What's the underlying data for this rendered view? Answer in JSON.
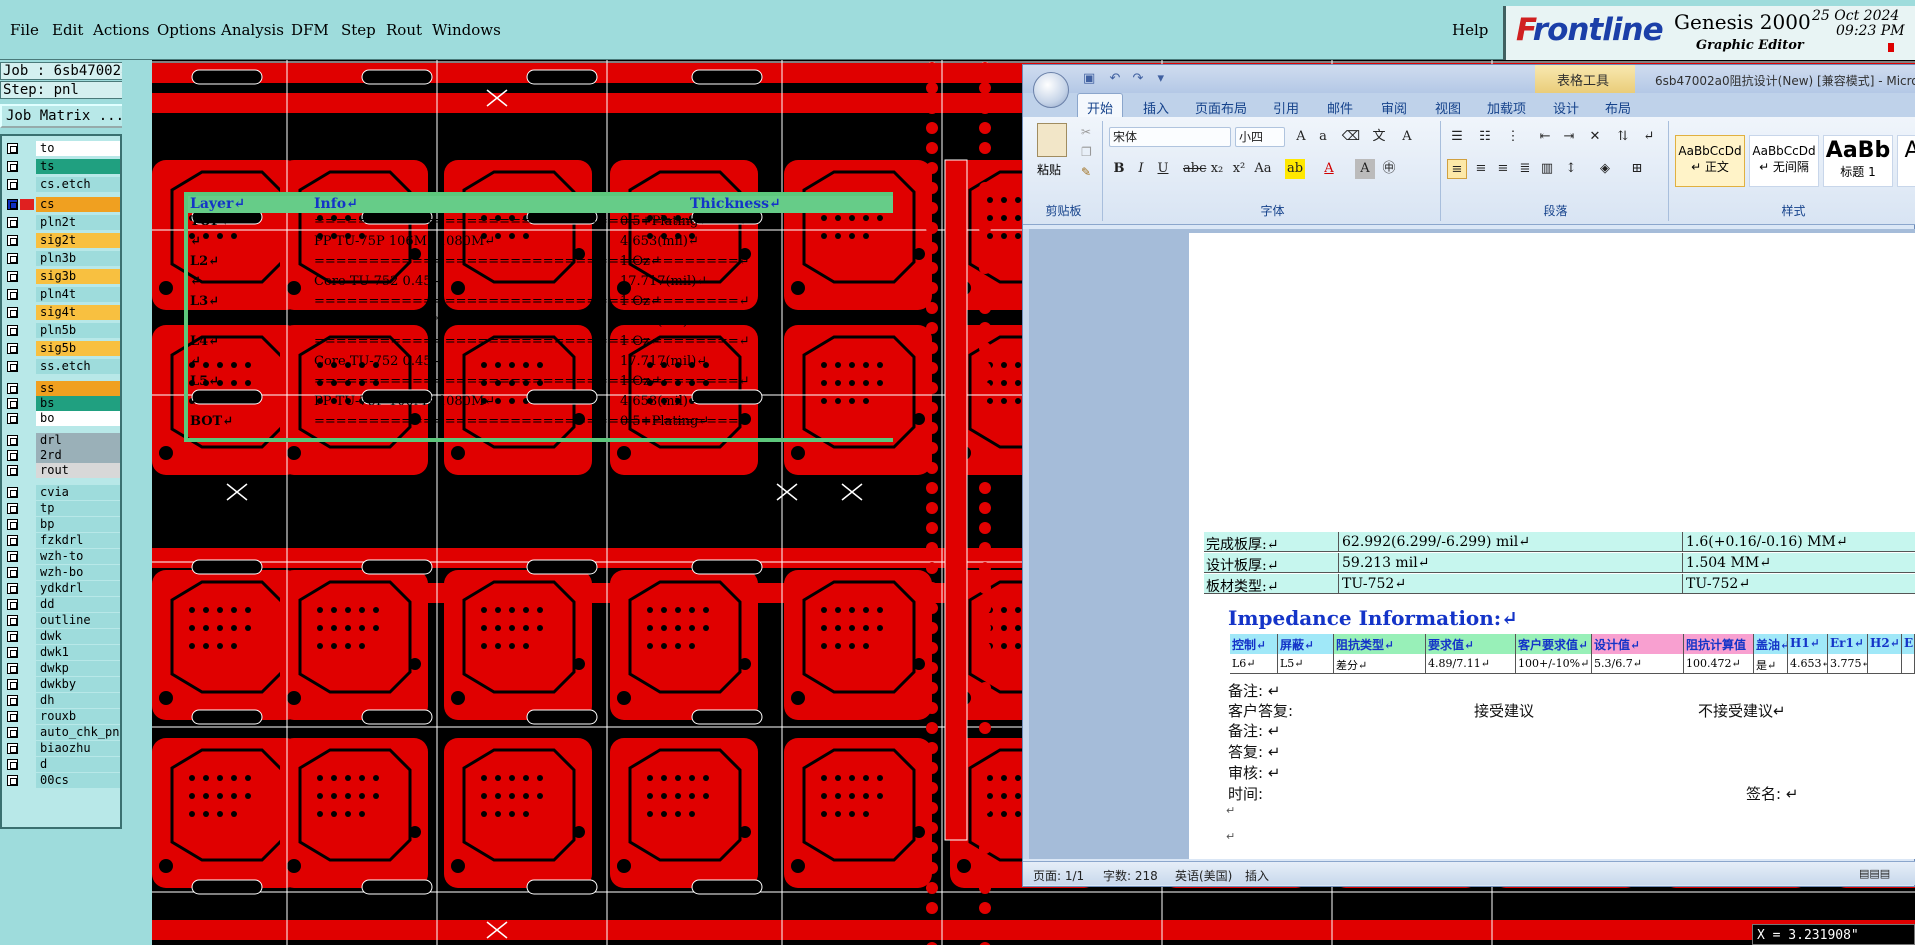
{
  "menu": {
    "items": [
      {
        "label": "File",
        "id": "file"
      },
      {
        "label": "Edit",
        "id": "edit"
      },
      {
        "label": "Actions",
        "id": "actions"
      },
      {
        "label": "Options",
        "id": "options"
      },
      {
        "label": "Analysis",
        "id": "analysis"
      },
      {
        "label": "DFM",
        "id": "dfm"
      },
      {
        "label": "Step",
        "id": "step"
      },
      {
        "label": "Rout",
        "id": "rout"
      },
      {
        "label": "Windows",
        "id": "windows"
      }
    ],
    "help": "Help"
  },
  "brand": {
    "logo_f": "F",
    "logo_rest": "rontline",
    "product": "Genesis 2000",
    "subtitle": "Graphic Editor",
    "date": "25 Oct 2024",
    "time": "09:23 PM"
  },
  "job": {
    "job_label": "Job : 6sb47002a0",
    "step_label": "Step: pnl",
    "matrix_button": "Job Matrix ..."
  },
  "layers": [
    {
      "name": "to",
      "color": "#ffffff"
    },
    {
      "name": "ts",
      "color": "#20a080"
    },
    {
      "name": "cs.etch",
      "color": "#9edcdc"
    },
    {
      "name": "cs",
      "color": "#f0a020",
      "active": true
    },
    {
      "name": "pln2t",
      "color": "#9edcdc"
    },
    {
      "name": "sig2t",
      "color": "#f8c040"
    },
    {
      "name": "pln3b",
      "color": "#9edcdc"
    },
    {
      "name": "sig3b",
      "color": "#f8c040"
    },
    {
      "name": "pln4t",
      "color": "#9edcdc"
    },
    {
      "name": "sig4t",
      "color": "#f8c040"
    },
    {
      "name": "pln5b",
      "color": "#9edcdc"
    },
    {
      "name": "sig5b",
      "color": "#f8c040"
    },
    {
      "name": "ss.etch",
      "color": "#9edcdc"
    },
    {
      "name": "ss",
      "color": "#f0a020"
    },
    {
      "name": "bs",
      "color": "#20a080"
    },
    {
      "name": "bo",
      "color": "#ffffff"
    },
    {
      "name": "drl",
      "color": "#9ab0b8"
    },
    {
      "name": "2rd",
      "color": "#9ab0b8"
    },
    {
      "name": "rout",
      "color": "#d8d8d8"
    },
    {
      "name": "cvia",
      "color": "#9edcdc"
    },
    {
      "name": "tp",
      "color": "#9edcdc"
    },
    {
      "name": "bp",
      "color": "#9edcdc"
    },
    {
      "name": "fzkdrl",
      "color": "#9edcdc"
    },
    {
      "name": "wzh-to",
      "color": "#9edcdc"
    },
    {
      "name": "wzh-bo",
      "color": "#9edcdc"
    },
    {
      "name": "ydkdrl",
      "color": "#9edcdc"
    },
    {
      "name": "dd",
      "color": "#9edcdc"
    },
    {
      "name": "outline",
      "color": "#9edcdc"
    },
    {
      "name": "dwk",
      "color": "#9edcdc"
    },
    {
      "name": "dwk1",
      "color": "#9edcdc"
    },
    {
      "name": "dwkp",
      "color": "#9edcdc"
    },
    {
      "name": "dwkby",
      "color": "#9edcdc"
    },
    {
      "name": "dh",
      "color": "#9edcdc"
    },
    {
      "name": "rouxb",
      "color": "#9edcdc"
    },
    {
      "name": "auto_chk_pn",
      "color": "#9edcdc"
    },
    {
      "name": "biaozhu",
      "color": "#9edcdc"
    },
    {
      "name": "d",
      "color": "#9edcdc"
    },
    {
      "name": "00cs",
      "color": "#9edcdc"
    }
  ],
  "word": {
    "title": "6sb47002a0阻抗设计(New) [兼容模式] - Micro",
    "table_tools": "表格工具",
    "tabs": [
      "开始",
      "插入",
      "页面布局",
      "引用",
      "邮件",
      "审阅",
      "视图",
      "加载项",
      "设计",
      "布局"
    ],
    "groups": {
      "clipboard": "剪贴板",
      "font": "字体",
      "paragraph": "段落",
      "styles": "样式"
    },
    "paste_label": "粘贴",
    "font_name": "宋体",
    "font_size": "小四",
    "styles": [
      {
        "sample": "AaBbCcDd",
        "name": "↵ 正文"
      },
      {
        "sample": "AaBbCcDd",
        "name": "↵ 无间隔"
      },
      {
        "sample": "AaBb",
        "name": "标题 1"
      }
    ],
    "status": {
      "page": "页面: 1/1",
      "words": "字数: 218",
      "lang": "英语(美国)",
      "mode": "插入"
    }
  },
  "stackup": {
    "headers": [
      "Layer↵",
      "Info↵",
      "Thickness↵"
    ],
    "rows": [
      {
        "layer": "TOP↵",
        "info": "=======================================↵",
        "thick": "0.5+Plating↵"
      },
      {
        "layer": "↵",
        "info": "PP     TU-75P    106M+1080M↵",
        "thick": "4.653(mil)↵"
      },
      {
        "layer": "L2↵",
        "info": "=======================================↵",
        "thick": "1 Oz↵"
      },
      {
        "layer": "↵",
        "info": "Core      TU-752     0.45↵",
        "thick": "17.717(mil)↵"
      },
      {
        "layer": "L3↵",
        "info": "=======================================↵",
        "thick": "1 Oz↵"
      },
      {
        "layer": "↵",
        "info": "PP     TU-75P     2116M*2↵",
        "thick": "8.093(mil)↵"
      },
      {
        "layer": "L4↵",
        "info": "=======================================↵",
        "thick": "1 Oz↵"
      },
      {
        "layer": "↵",
        "info": "Core      TU-752     0.45↵",
        "thick": "17.717(mil)↵"
      },
      {
        "layer": "L5↵",
        "info": "=======================================↵",
        "thick": "1 Oz↵"
      },
      {
        "layer": "↵",
        "info": "PP     TU-75P    106M+1080M↵",
        "thick": "4.653(mil)↵"
      },
      {
        "layer": "BOT↵",
        "info": "=======================================↵",
        "thick": "0.5+Plating↵"
      }
    ]
  },
  "board": [
    {
      "label": "完成板厚:↵",
      "mil": "62.992(6.299/-6.299) mil↵",
      "mm": "1.6(+0.16/-0.16) MM↵"
    },
    {
      "label": "设计板厚:↵",
      "mil": "59.213 mil↵",
      "mm": "1.504 MM↵"
    },
    {
      "label": "板材类型:↵",
      "mil": "TU-752↵",
      "mm": "TU-752↵"
    }
  ],
  "impedance": {
    "title": "Impedance Information:↵",
    "headers": [
      "控制↵",
      "屏蔽↵",
      "阻抗类型↵",
      "要求值↵",
      "客户要求值↵",
      "设计值↵",
      "阻抗计算值",
      "盖油↵",
      "H1↵",
      "Er1↵",
      "H2↵",
      "E"
    ],
    "row": [
      "L6↵",
      "L5↵",
      "差分↵",
      "4.89/7.11↵",
      "100+/-10%↵",
      "5.3/6.7↵",
      "100.472↵",
      "是↵",
      "4.653↵",
      "3.775↵",
      "",
      ""
    ]
  },
  "notes": {
    "remark1": "备注: ↵",
    "customer_reply": "客户答复:",
    "accept": "接受建议",
    "reject": "不接受建议↵",
    "remark2": "备注: ↵",
    "answer": "答复: ↵",
    "audit": "审核: ↵",
    "time": "时间:",
    "sign": "签名: ↵",
    "blank1": "↵",
    "blank2": "↵"
  },
  "coord": "X = 3.231908\""
}
